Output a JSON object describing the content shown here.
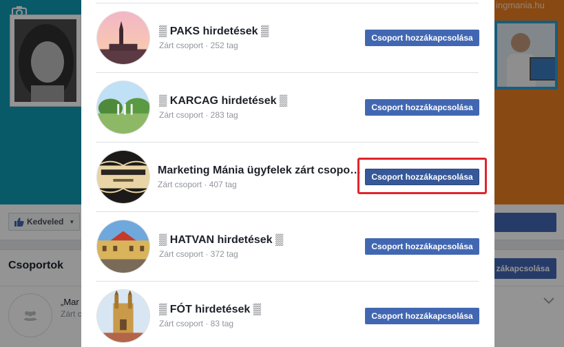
{
  "background": {
    "site_text": "ingmania.hu",
    "like_button": "Kedveled",
    "groups_title": "Csoportok",
    "add_button_partial": "zákapcsolása",
    "group_name_partial": "„Mar",
    "group_meta_partial": "Zárt c"
  },
  "dialog": {
    "rows": [
      {
        "name": "▒ PAKS hirdetések ▒",
        "meta": "Zárt csoport · 252 tag",
        "button": "Csoport hozzákapcsolása"
      },
      {
        "name": "▒ KARCAG hirdetések ▒",
        "meta": "Zárt csoport · 283 tag",
        "button": "Csoport hozzákapcsolása"
      },
      {
        "name": "Marketing Mánia ügyfelek zárt csopo…",
        "meta": "Zárt csoport · 407 tag",
        "button": "Csoport hozzákapcsolása"
      },
      {
        "name": "▒ HATVAN hirdetések ▒",
        "meta": "Zárt csoport · 372 tag",
        "button": "Csoport hozzákapcsolása"
      },
      {
        "name": "▒ FÓT hirdetések ▒",
        "meta": "Zárt csoport · 83 tag",
        "button": "Csoport hozzákapcsolása"
      }
    ]
  },
  "colors": {
    "button_blue": "#4267b2",
    "highlight_red": "#e0222b",
    "cover_teal": "#0f9bb5",
    "cover_orange": "#ec7e21"
  }
}
